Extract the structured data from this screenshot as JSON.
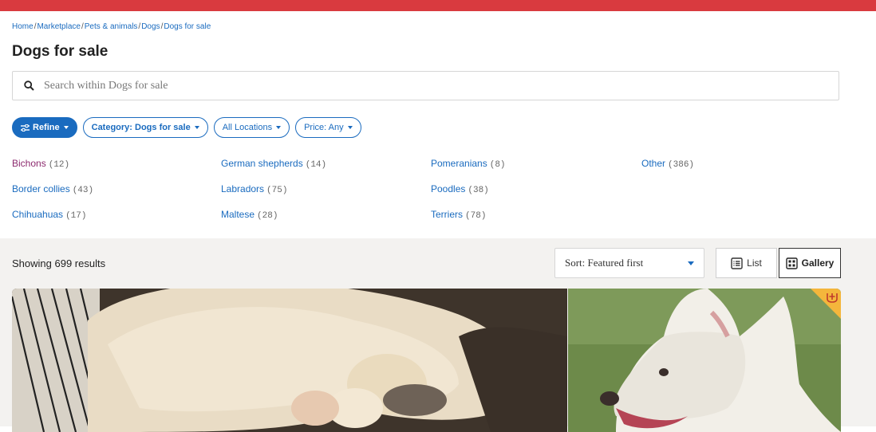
{
  "colors": {
    "brand_red": "#d93a3f",
    "link_blue": "#1a6bbf",
    "visited": "#8c2a6e",
    "badge": "#f4b63c"
  },
  "breadcrumb": {
    "home": "Home",
    "marketplace": "Marketplace",
    "pets": "Pets & animals",
    "dogs": "Dogs",
    "current": "Dogs for sale",
    "separator": "/"
  },
  "page": {
    "title": "Dogs for sale"
  },
  "search": {
    "placeholder": "Search within Dogs for sale",
    "value": ""
  },
  "filters": {
    "refine": "Refine",
    "category": "Category: Dogs for sale",
    "location": "All Locations",
    "price": "Price: Any"
  },
  "breeds": [
    {
      "name": "Bichons",
      "count": "(12)"
    },
    {
      "name": "Border collies",
      "count": "(43)"
    },
    {
      "name": "Chihuahuas",
      "count": "(17)"
    },
    {
      "name": "German shepherds",
      "count": "(14)"
    },
    {
      "name": "Labradors",
      "count": "(75)"
    },
    {
      "name": "Maltese",
      "count": "(28)"
    },
    {
      "name": "Pomeranians",
      "count": "(8)"
    },
    {
      "name": "Poodles",
      "count": "(38)"
    },
    {
      "name": "Terriers",
      "count": "(78)"
    },
    {
      "name": "Other",
      "count": "(386)"
    }
  ],
  "results": {
    "showing": "Showing 699 results",
    "sort": "Sort: Featured first",
    "list_label": "List",
    "gallery_label": "Gallery"
  },
  "icons": {
    "search": "search-icon",
    "refine": "sliders-icon",
    "list": "list-view-icon",
    "gallery": "gallery-view-icon",
    "badge": "featured-badge-icon"
  }
}
